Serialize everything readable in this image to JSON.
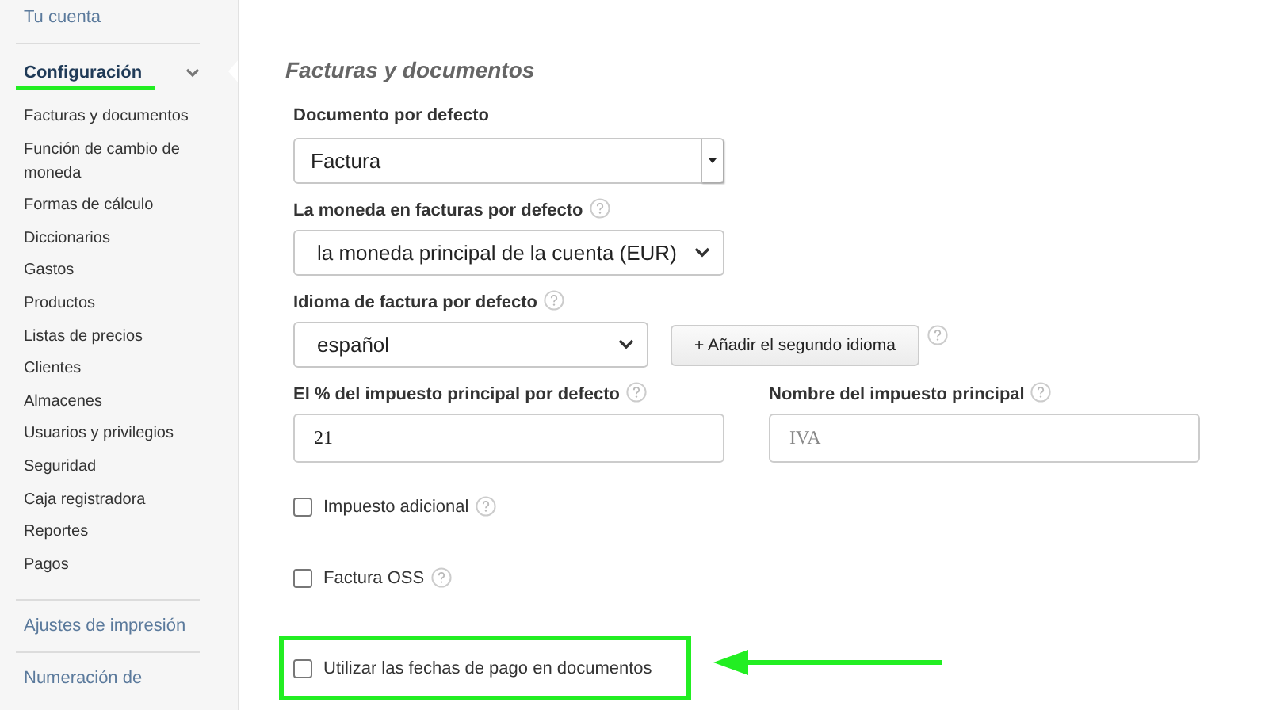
{
  "sidebar": {
    "top_link": "Tu cuenta",
    "section": {
      "title": "Configuración",
      "expanded": true,
      "highlighted": true
    },
    "items": [
      "Facturas y documentos",
      "Función de cambio de moneda",
      "Formas de cálculo",
      "Diccionarios",
      "Gastos",
      "Productos",
      "Listas de precios",
      "Clientes",
      "Almacenes",
      "Usuarios y privilegios",
      "Seguridad",
      "Caja registradora",
      "Reportes",
      "Pagos"
    ],
    "bottom_links": [
      "Ajustes de impresión",
      "Numeración de"
    ]
  },
  "main": {
    "title": "Facturas y documentos",
    "rows": [
      {
        "fields": [
          {
            "kind": "dropdown-boxed",
            "label": "Documento por defecto",
            "help": false,
            "value": "Factura"
          }
        ]
      },
      {
        "fields": [
          {
            "kind": "dropdown",
            "label": "La moneda en facturas por defecto",
            "help": true,
            "value": "la moneda principal de la cuenta (EUR)"
          }
        ]
      },
      {
        "fields": [
          {
            "kind": "dropdown-short",
            "label": "Idioma de factura por defecto",
            "help": true,
            "value": "español",
            "button": "+ Añadir el segundo idioma",
            "button_help": true
          }
        ]
      },
      {
        "fields": [
          {
            "kind": "input",
            "label": "El % del impuesto principal por defecto",
            "help": true,
            "value": "21"
          },
          {
            "kind": "input",
            "label": "Nombre del impuesto principal",
            "help": true,
            "placeholder": "IVA"
          }
        ]
      }
    ],
    "checkboxes": [
      {
        "label": "Impuesto adicional",
        "checked": false,
        "help": true,
        "highlighted": false
      },
      {
        "label": "Factura OSS",
        "checked": false,
        "help": true,
        "highlighted": false
      },
      {
        "label": "Utilizar las fechas de pago en documentos",
        "checked": false,
        "help": false,
        "highlighted": true
      }
    ]
  }
}
